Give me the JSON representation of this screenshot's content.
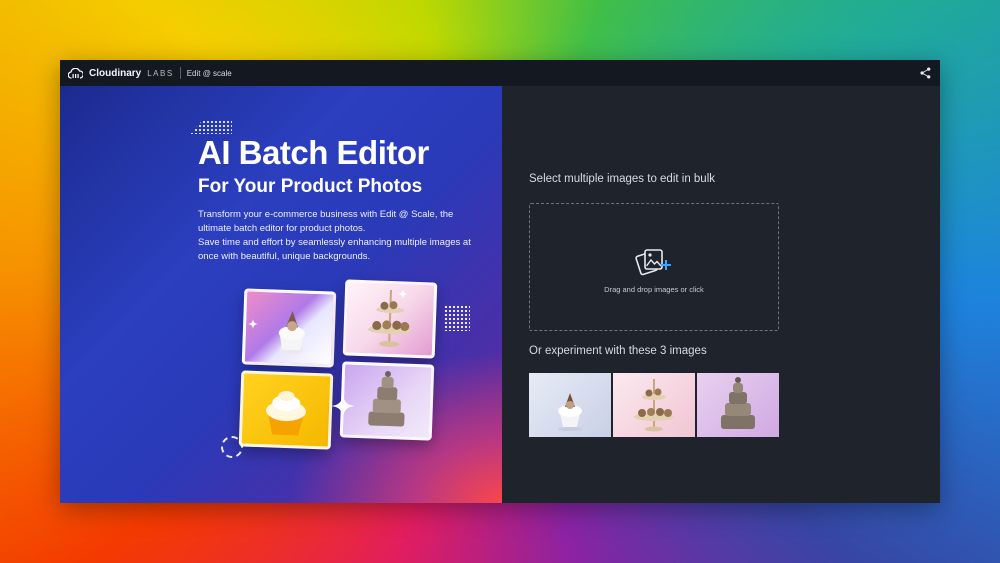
{
  "header": {
    "brand_name": "Cloudinary",
    "brand_labs": "LABS",
    "app_name": "Edit @ scale"
  },
  "hero": {
    "title": "AI Batch Editor",
    "subtitle": "For Your Product Photos",
    "description_1": "Transform your e-commerce business with Edit @ Scale, the ultimate batch editor for product photos.",
    "description_2": "Save time and effort by seamlessly enhancing multiple images at once with beautiful, unique backgrounds."
  },
  "upload": {
    "select_label": "Select multiple images to edit in bulk",
    "dropzone_text": "Drag and drop images or click"
  },
  "samples": {
    "label": "Or experiment with these 3 images"
  },
  "colors": {
    "app_background": "#1f232c",
    "topbar_background": "#141820",
    "accent": "#3ea6ff"
  }
}
